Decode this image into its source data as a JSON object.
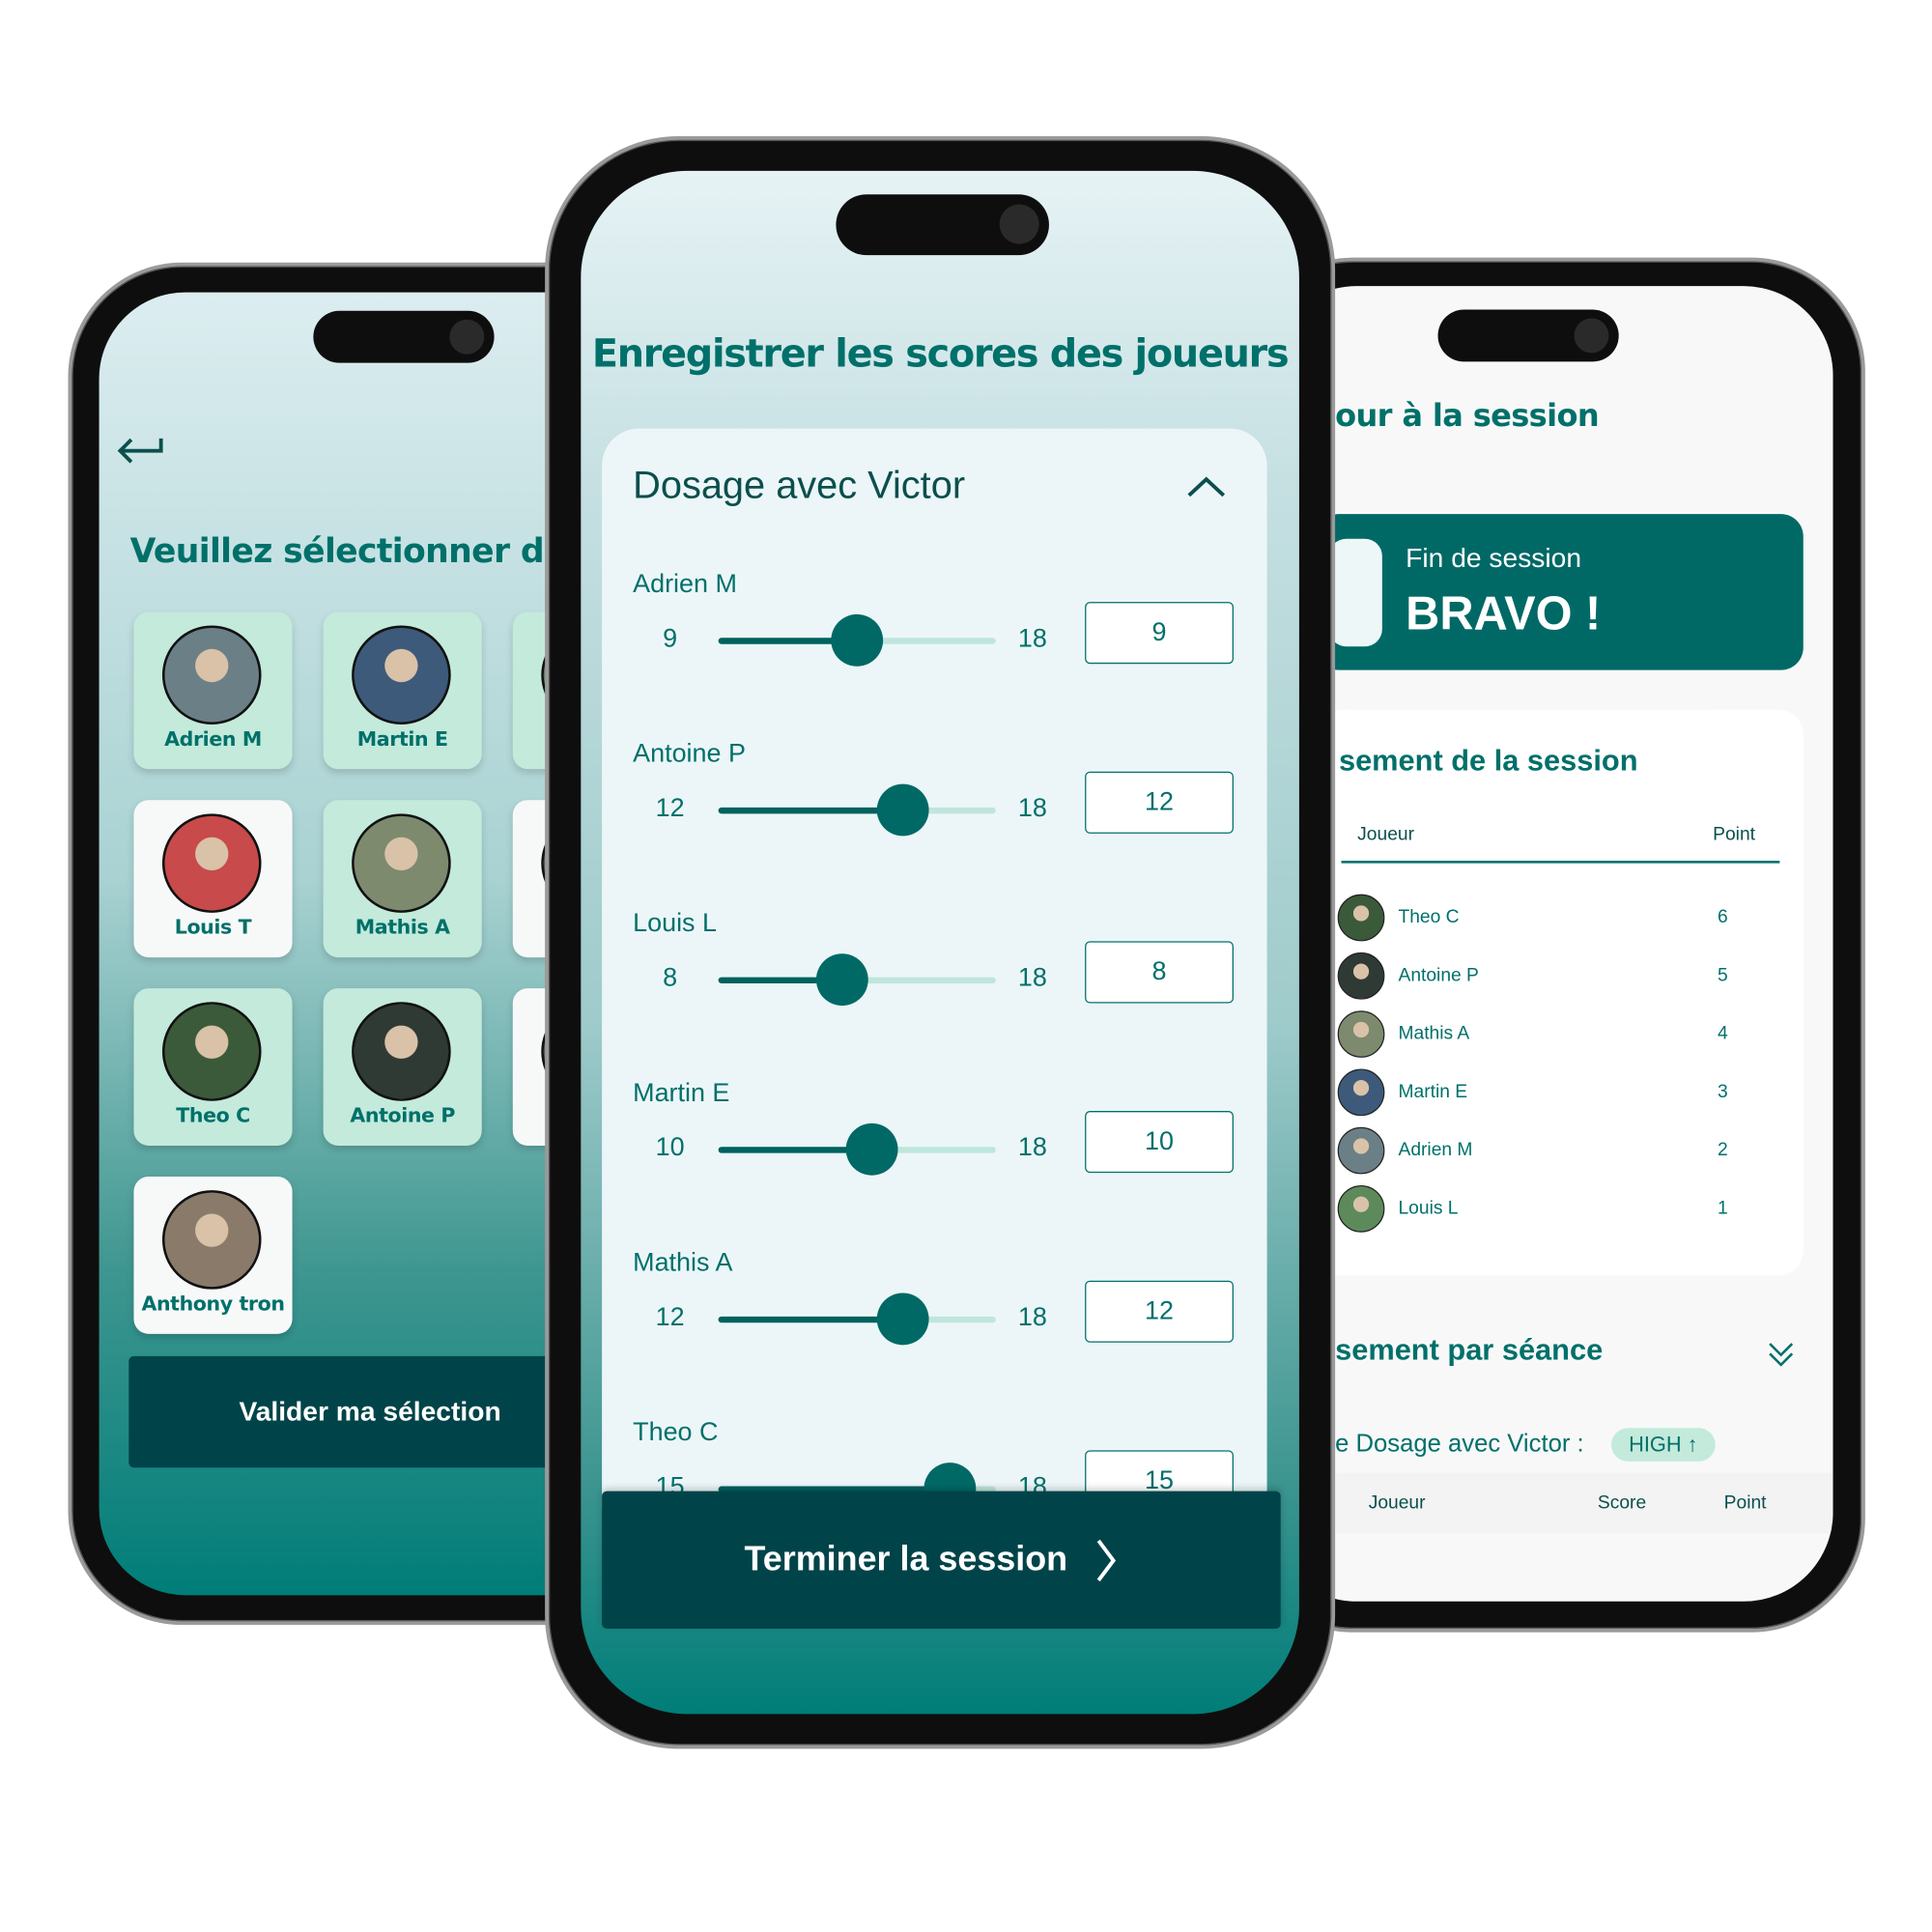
{
  "colors": {
    "primary": "#00706a",
    "dark_button": "#004449",
    "selected_card": "#c3eadb",
    "unselected_card": "#f7f9f9",
    "banner": "#006966"
  },
  "left_screen": {
    "back_icon": "return-arrow-icon",
    "title": "Veuillez sélectionner des",
    "players": [
      {
        "name": "Adrien M",
        "selected": true,
        "avatar": "#6b7f86"
      },
      {
        "name": "Martin E",
        "selected": true,
        "avatar": "#3d5a7a"
      },
      {
        "name": "",
        "selected": true,
        "avatar": "#5a7a5a"
      },
      {
        "name": "Louis T",
        "selected": false,
        "avatar": "#c84a4a"
      },
      {
        "name": "Mathis A",
        "selected": true,
        "avatar": "#7d8a6e"
      },
      {
        "name": "",
        "selected": false,
        "avatar": "#555"
      },
      {
        "name": "Theo C",
        "selected": true,
        "avatar": "#3b5a3a"
      },
      {
        "name": "Antoine P",
        "selected": true,
        "avatar": "#2f3a35"
      },
      {
        "name": "",
        "selected": false,
        "avatar": "#555"
      },
      {
        "name": "Anthony tron",
        "selected": false,
        "avatar": "#8a7a6a"
      }
    ],
    "validate_button": "Valider ma sélection"
  },
  "middle_screen": {
    "title": "Enregistrer les scores des joueurs",
    "card_title": "Dosage avec Victor",
    "collapse_icon": "chevron-up-icon",
    "scores": [
      {
        "player": "Adrien M",
        "value": 9,
        "max": 18
      },
      {
        "player": "Antoine P",
        "value": 12,
        "max": 18
      },
      {
        "player": "Louis L",
        "value": 8,
        "max": 18
      },
      {
        "player": "Martin E",
        "value": 10,
        "max": 18
      },
      {
        "player": "Mathis A",
        "value": 12,
        "max": 18
      },
      {
        "player": "Theo C",
        "value": 15,
        "max": 18
      }
    ],
    "finish_button": "Terminer la session",
    "finish_icon": "chevron-right-icon"
  },
  "right_screen": {
    "title": "our à la session",
    "banner_subtitle": "Fin de session",
    "banner_title": "BRAVO !",
    "ranking_title": "sement de la session",
    "ranking_headers": {
      "player": "Joueur",
      "point": "Point"
    },
    "ranking": [
      {
        "name": "Theo C",
        "point": "6",
        "avatar": "#3b5a3a"
      },
      {
        "name": "Antoine P",
        "point": "5",
        "avatar": "#2f3a35"
      },
      {
        "name": "Mathis A",
        "point": "4",
        "avatar": "#7d8a6e"
      },
      {
        "name": "Martin E",
        "point": "3",
        "avatar": "#3d5a7a"
      },
      {
        "name": "Adrien M",
        "point": "2",
        "avatar": "#6b7f86"
      },
      {
        "name": "Louis L",
        "point": "1",
        "avatar": "#5d8a5a"
      }
    ],
    "session_title": "sement par séance",
    "session_expand_icon": "double-chevron-down-icon",
    "session_label": "e Dosage avec Victor :",
    "level_badge": "HIGH ↑",
    "session_headers": {
      "player": "Joueur",
      "score": "Score",
      "point": "Point"
    }
  }
}
